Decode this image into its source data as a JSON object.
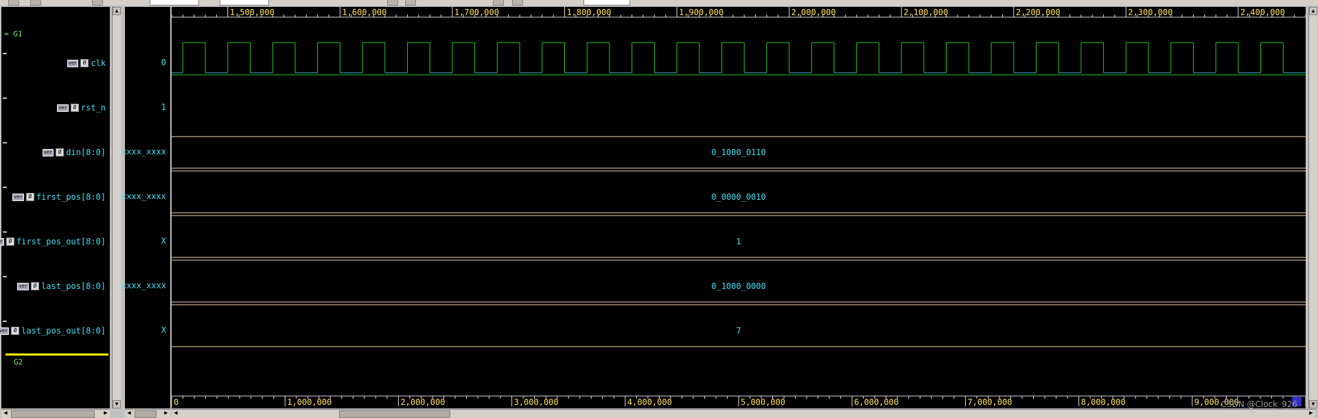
{
  "groups": [
    {
      "label": "= G1"
    },
    {
      "label": "G2"
    }
  ],
  "signals": [
    {
      "name": "clk",
      "value": "0",
      "badge": "ver",
      "wave_label": ""
    },
    {
      "name": "rst_n",
      "value": "1",
      "badge": "ver",
      "wave_label": ""
    },
    {
      "name": "din[8:0]",
      "value": "xxxx_xxxx",
      "badge": "ver",
      "wave_label": "0_1000_0110"
    },
    {
      "name": "first_pos[8:0]",
      "value": "xxxx_xxxx",
      "badge": "ver",
      "wave_label": "0_0000_0010"
    },
    {
      "name": "first_pos_out[8:0]",
      "value": "X",
      "badge": "ver",
      "wave_label": "1"
    },
    {
      "name": "last_pos[8:0]",
      "value": "xxxx_xxxx",
      "badge": "ver",
      "wave_label": "0_1000_0000"
    },
    {
      "name": "last_pos_out[8:0]",
      "value": "X",
      "badge": "ver",
      "wave_label": "7"
    }
  ],
  "top_ruler": {
    "labels": [
      "1,500,000",
      "1,600,000",
      "1,700,000",
      "1,800,000",
      "1,900,000",
      "2,000,000",
      "2,100,000",
      "2,200,000",
      "2,300,000",
      "2,400,000"
    ],
    "start": 1450000,
    "end": 2460000
  },
  "bottom_ruler": {
    "labels": [
      "0",
      "1,000,000",
      "2,000,000",
      "3,000,000",
      "4,000,000",
      "5,000,000",
      "6,000,000",
      "7,000,000",
      "8,000,000",
      "9,000,000"
    ],
    "start": 0,
    "end": 10000000
  },
  "clock": {
    "period": 40000,
    "high_first": true
  },
  "colors": {
    "clock_high": "#20d020",
    "clock_low": "#3fb8e0",
    "bus": "#f0d8b0",
    "ruler_text": "#ffe060",
    "signal_text": "#3fe0f0",
    "group_text": "#6ff06f",
    "marker": "#ffff00"
  },
  "watermark": "CSDN @Clock_926"
}
